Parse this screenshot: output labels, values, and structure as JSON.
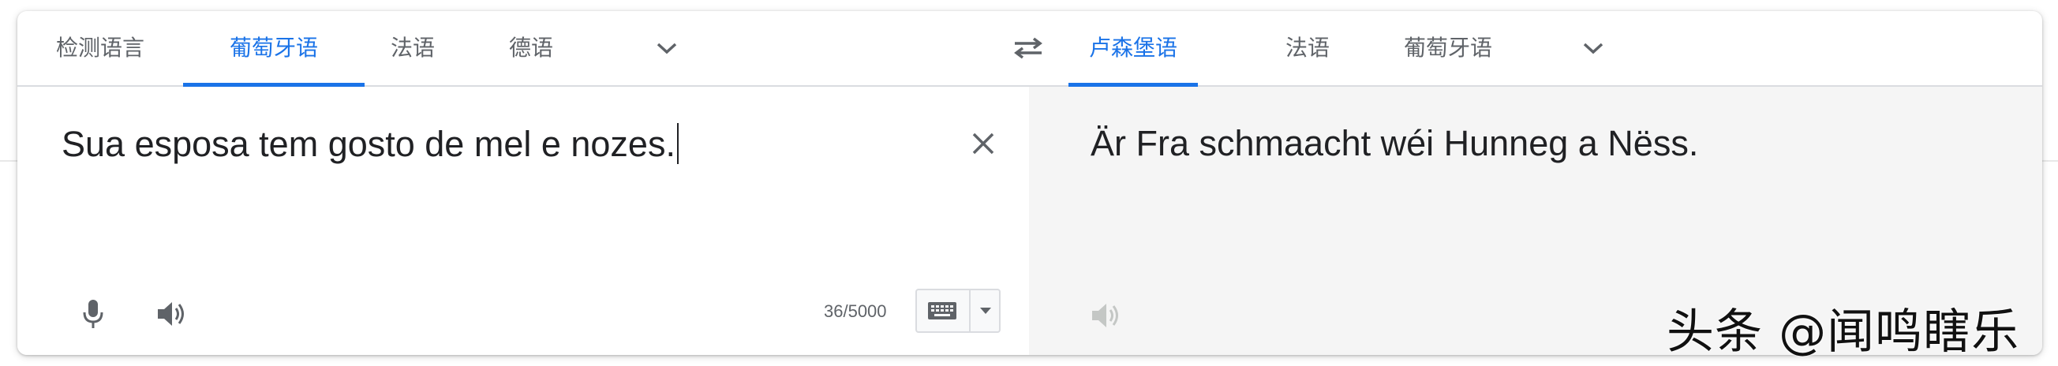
{
  "source_langs": {
    "tabs": [
      {
        "label": "检测语言",
        "active": false
      },
      {
        "label": "葡萄牙语",
        "active": true
      },
      {
        "label": "法语",
        "active": false
      },
      {
        "label": "德语",
        "active": false
      }
    ],
    "more_icon": "chevron-down-icon"
  },
  "swap_icon": "swap-arrows-icon",
  "target_langs": {
    "tabs": [
      {
        "label": "卢森堡语",
        "active": true
      },
      {
        "label": "法语",
        "active": false
      },
      {
        "label": "葡萄牙语",
        "active": false
      }
    ],
    "more_icon": "chevron-down-icon"
  },
  "source": {
    "text": "Sua esposa tem gosto de mel e nozes.",
    "char_count": "36/5000",
    "clear_icon": "close-icon",
    "mic_icon": "microphone-icon",
    "speaker_icon": "speaker-icon",
    "keyboard_icon": "keyboard-icon"
  },
  "target": {
    "text": "Är Fra schmaacht wéi Hunneg a Nëss.",
    "speaker_icon": "speaker-icon"
  },
  "watermark": "头条 @闻鸣瞎乐",
  "colors": {
    "accent": "#1a73e8",
    "text": "#202124",
    "muted": "#5f6368",
    "target_bg": "#f5f5f5"
  }
}
